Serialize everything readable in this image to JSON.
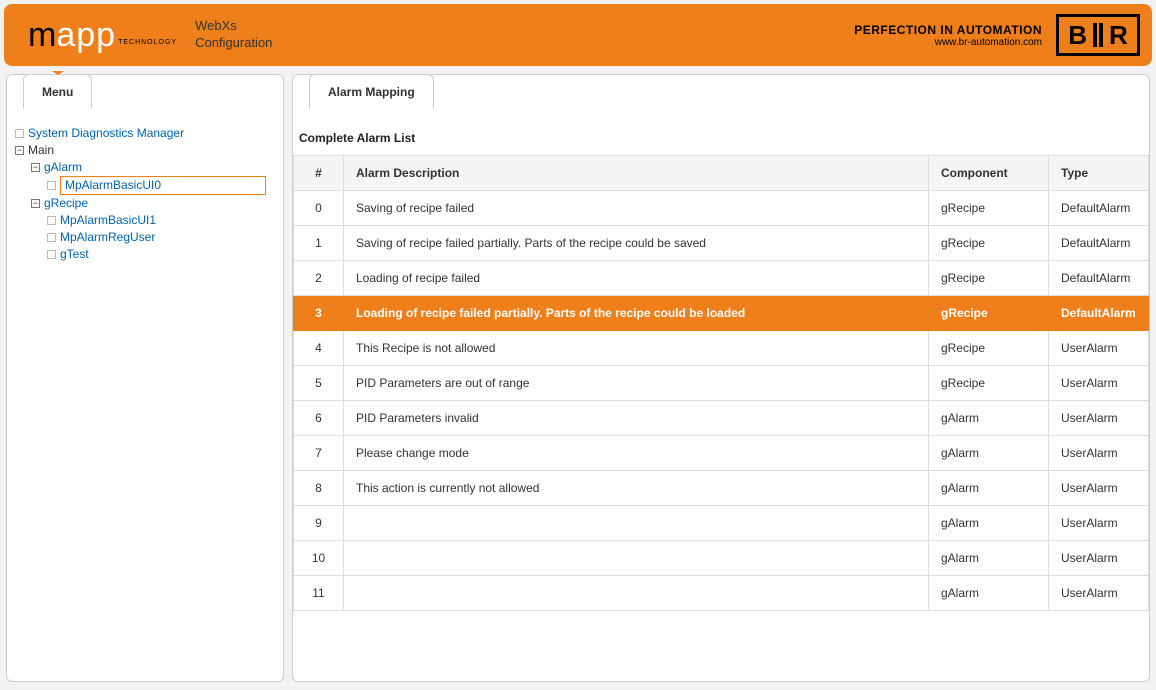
{
  "header": {
    "logo_m": "m",
    "logo_app": "app",
    "logo_tech": "TECHNOLOGY",
    "title_line1": "WebXs",
    "title_line2": "Configuration",
    "perfection_title": "PERFECTION IN AUTOMATION",
    "perfection_url": "www.br-automation.com",
    "br_b": "B",
    "br_r": "R"
  },
  "left": {
    "tab": "Menu",
    "tree": {
      "sdm": "System Diagnostics Manager",
      "main": "Main",
      "gAlarm": "gAlarm",
      "mpAlarmBasicUI0": "MpAlarmBasicUI0",
      "gRecipe": "gRecipe",
      "mpAlarmBasicUI1": "MpAlarmBasicUI1",
      "mpAlarmRegUser": "MpAlarmRegUser",
      "gTest": "gTest"
    }
  },
  "right": {
    "tab": "Alarm Mapping",
    "list_title": "Complete Alarm List",
    "columns": {
      "idx": "#",
      "desc": "Alarm Description",
      "comp": "Component",
      "type": "Type"
    },
    "selected_index": 3,
    "rows": [
      {
        "idx": "0",
        "desc": "Saving of recipe failed",
        "comp": "gRecipe",
        "type": "DefaultAlarm"
      },
      {
        "idx": "1",
        "desc": "Saving of recipe failed partially. Parts of the recipe could be saved",
        "comp": "gRecipe",
        "type": "DefaultAlarm"
      },
      {
        "idx": "2",
        "desc": "Loading of recipe failed",
        "comp": "gRecipe",
        "type": "DefaultAlarm"
      },
      {
        "idx": "3",
        "desc": "Loading of recipe failed partially. Parts of the recipe could be loaded",
        "comp": "gRecipe",
        "type": "DefaultAlarm"
      },
      {
        "idx": "4",
        "desc": "This Recipe is not allowed",
        "comp": "gRecipe",
        "type": "UserAlarm"
      },
      {
        "idx": "5",
        "desc": "PID Parameters are out of range",
        "comp": "gRecipe",
        "type": "UserAlarm"
      },
      {
        "idx": "6",
        "desc": "PID Parameters invalid",
        "comp": "gAlarm",
        "type": "UserAlarm"
      },
      {
        "idx": "7",
        "desc": "Please change mode",
        "comp": "gAlarm",
        "type": "UserAlarm"
      },
      {
        "idx": "8",
        "desc": "This action is currently not allowed",
        "comp": "gAlarm",
        "type": "UserAlarm"
      },
      {
        "idx": "9",
        "desc": "",
        "comp": "gAlarm",
        "type": "UserAlarm"
      },
      {
        "idx": "10",
        "desc": "",
        "comp": "gAlarm",
        "type": "UserAlarm"
      },
      {
        "idx": "11",
        "desc": "",
        "comp": "gAlarm",
        "type": "UserAlarm"
      }
    ]
  }
}
